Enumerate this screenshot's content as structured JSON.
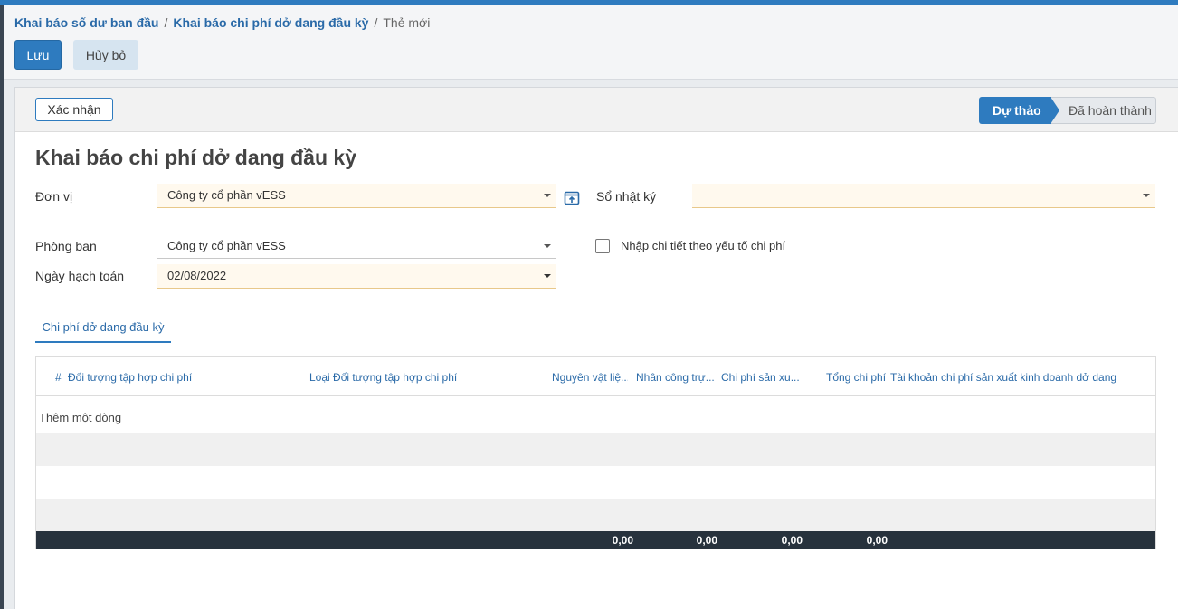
{
  "breadcrumb": {
    "items": [
      "Khai báo số dư ban đầu",
      "Khai báo chi phí dở dang đầu kỳ"
    ],
    "current": "Thẻ mới",
    "separator": "/"
  },
  "toolbar": {
    "save_label": "Lưu",
    "cancel_label": "Hủy bỏ"
  },
  "statusbar": {
    "confirm_label": "Xác nhận",
    "stages": [
      "Dự thảo",
      "Đã hoàn thành"
    ],
    "active_stage": "Dự thảo"
  },
  "form": {
    "title": "Khai báo chi phí dở dang đầu kỳ",
    "fields": {
      "don_vi": {
        "label": "Đơn vị",
        "value": "Công ty cổ phần vESS"
      },
      "so_nhat_ky": {
        "label": "Sổ nhật ký",
        "value": ""
      },
      "phong_ban": {
        "label": "Phòng ban",
        "value": "Công ty cổ phần vESS"
      },
      "ngay_hach_toan": {
        "label": "Ngày hạch toán",
        "value": "02/08/2022"
      },
      "nhap_chi_tiet": {
        "label": "Nhập chi tiết theo yếu tố chi phí",
        "checked": false
      }
    }
  },
  "tabs": [
    {
      "label": "Chi phí dở dang đầu kỳ",
      "active": true
    }
  ],
  "table": {
    "columns": [
      "#",
      "Đối tượng tập hợp chi phí",
      "Loại Đối tượng tập hợp chi phí",
      "Nguyên vật liệ...",
      "Nhân công trự...",
      "Chi phí sản xu...",
      "Tổng chi phí",
      "Tài khoản chi phí sản xuất kinh doanh dở dang"
    ],
    "add_line_label": "Thêm một dòng",
    "totals": [
      "0,00",
      "0,00",
      "0,00",
      "0,00"
    ]
  },
  "colors": {
    "primary": "#2e7bbf",
    "link": "#2a6aa8",
    "footer": "#27323d",
    "required_bg": "#fff9ee"
  },
  "icons": {
    "external_link": "external-link-icon",
    "dropdown": "chevron-down-icon"
  }
}
